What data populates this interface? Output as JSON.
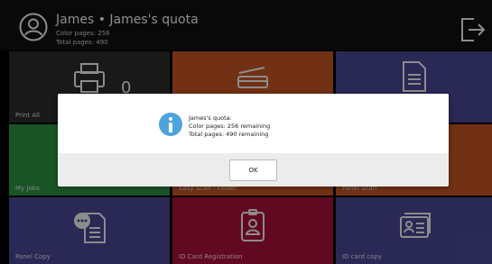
{
  "header": {
    "title": "James • James's quota",
    "color_pages": "Color pages: 256",
    "total_pages": "Total pages: 490"
  },
  "tiles": {
    "print_all": {
      "label": "Print All",
      "count": "0",
      "color": "#2e2e2e"
    },
    "scan_orange": {
      "label": "",
      "color": "#cf5a25"
    },
    "scan_purple": {
      "label": "",
      "color": "#4e4a9c"
    },
    "my_jobs": {
      "label": "My Jobs",
      "color": "#2e9a46"
    },
    "easy_scan_folder": {
      "label": "Easy Scan - Folder",
      "color": "#cf5a25"
    },
    "panel_scan": {
      "label": "Panel Scan",
      "color": "#cf5a25"
    },
    "panel_copy": {
      "label": "Panel Copy",
      "color": "#4e4a9c"
    },
    "id_card_registration": {
      "label": "ID Card Registration",
      "color": "#b3123e"
    },
    "id_card_copy": {
      "label": "ID card copy",
      "color": "#4e4a9c"
    }
  },
  "dialog": {
    "line1": "James's quota:",
    "line2": "Color pages:  256  remaining",
    "line3": "Total pages:  490 remaining",
    "ok_label": "OK"
  },
  "icons": {
    "avatar": "user-circle-icon",
    "logout": "logout-icon",
    "info": "info-icon",
    "printer": "printer-icon",
    "scanner": "scanner-icon",
    "document": "document-icon",
    "copy": "copy-document-icon",
    "badge": "id-badge-icon",
    "id_card": "id-card-icon"
  }
}
